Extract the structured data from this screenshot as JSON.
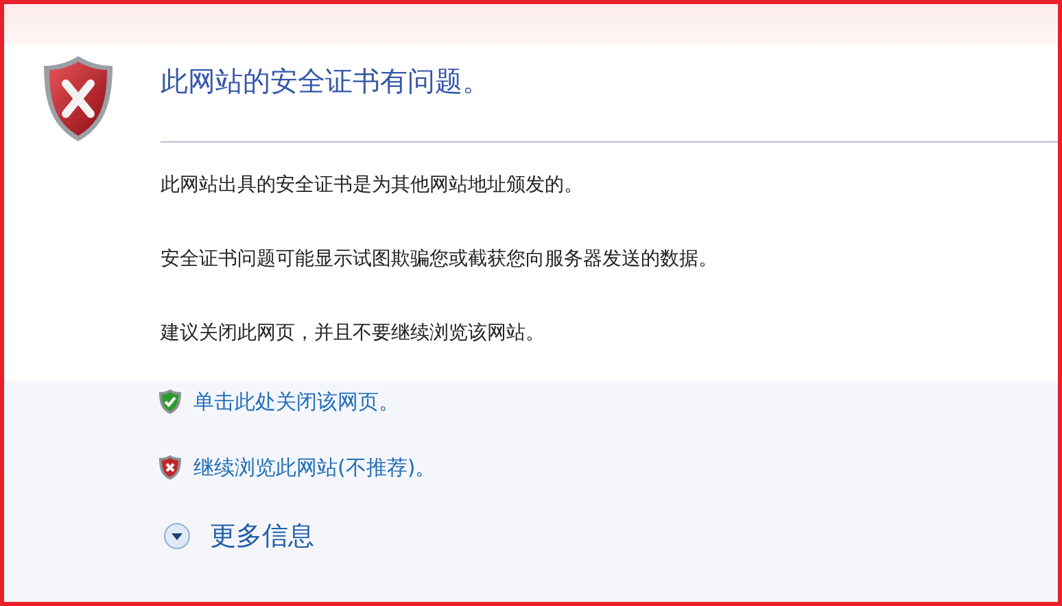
{
  "title": "此网站的安全证书有问题。",
  "paragraphs": [
    "此网站出具的安全证书是为其他网站地址颁发的。",
    "安全证书问题可能显示试图欺骗您或截获您向服务器发送的数据。",
    "建议关闭此网页，并且不要继续浏览该网站。"
  ],
  "links": [
    {
      "kind": "safe",
      "label": "单击此处关闭该网页。"
    },
    {
      "kind": "unsafe",
      "label": "继续浏览此网站(不推荐)。"
    }
  ],
  "more_info": {
    "label": "更多信息"
  }
}
